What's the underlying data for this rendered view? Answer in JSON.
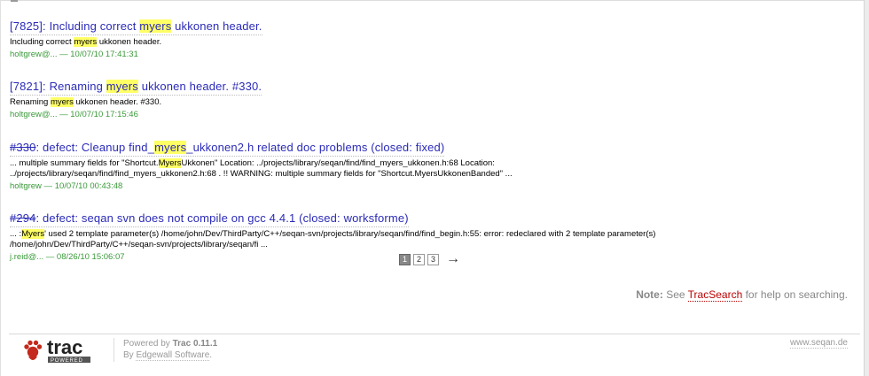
{
  "results": [
    {
      "ticket": "",
      "title_pre": "[7825]: Including correct ",
      "title_hl": "myers",
      "title_post": " ukkonen header.",
      "excerpt_pre": "Including correct ",
      "excerpt_hl": "myers",
      "excerpt_post": " ukkonen header.",
      "author": "holtgrew@...",
      "date": " — 10/07/10 17:41:31"
    },
    {
      "ticket": "",
      "title_pre": "[7821]: Renaming ",
      "title_hl": "myers",
      "title_post": " ukkonen header. #330.",
      "excerpt_pre": "Renaming ",
      "excerpt_hl": "myers",
      "excerpt_post": " ukkonen header. #330.",
      "author": "holtgrew@...",
      "date": " — 10/07/10 17:15:46"
    },
    {
      "ticket": "#330",
      "title_pre": ": defect: Cleanup find_",
      "title_hl": "myers",
      "title_post": "_ukkonen2.h related doc problems (closed: fixed)",
      "excerpt_pre": "... multiple summary fields for \"Shortcut.",
      "excerpt_hl": "Myers",
      "excerpt_post": "Ukkonen\" Location: ../projects/library/seqan/find/find_myers_ukkonen.h:68 Location:\n../projects/library/seqan/find/find_myers_ukkonen2.h:68 . !! WARNING: multiple summary fields for \"Shortcut.MyersUkkonenBanded\" ...",
      "author": "holtgrew",
      "date": " — 10/07/10 00:43:48"
    },
    {
      "ticket": "#294",
      "title_pre": ": defect: seqan svn does not compile on gcc 4.4.1 (closed: worksforme)",
      "title_hl": "",
      "title_post": "",
      "excerpt_pre": "... :",
      "excerpt_hl": "Myers",
      "excerpt_post": "' used 2 template parameter(s) /home/john/Dev/ThirdParty/C++/seqan-svn/projects/library/seqan/find/find_begin.h:55: error: redeclared with 2 template parameter(s)\n/home/john/Dev/ThirdParty/C++/seqan-svn/projects/library/seqan/fi ...",
      "author": "j.reid@...",
      "date": " — 08/26/10 15:06:07"
    }
  ],
  "paging": {
    "pages": [
      "1",
      "2",
      "3"
    ],
    "current": "1",
    "next": "→"
  },
  "note": {
    "label": "Note:",
    "pre": " See ",
    "link": "TracSearch",
    "post": " for help on searching."
  },
  "footer": {
    "logo_alt": "trac",
    "logo_sub": "POWERED",
    "powered_pre": "Powered by ",
    "powered_strong": "Trac 0.11.1",
    "by_pre": "By ",
    "by_link": "Edgewall Software",
    "by_post": ".",
    "site": "www.seqan.de"
  },
  "colors": {
    "link": "#2b2bb8",
    "highlight": "#ffff66",
    "author": "#3a9a3a",
    "trac_red": "#b00"
  }
}
